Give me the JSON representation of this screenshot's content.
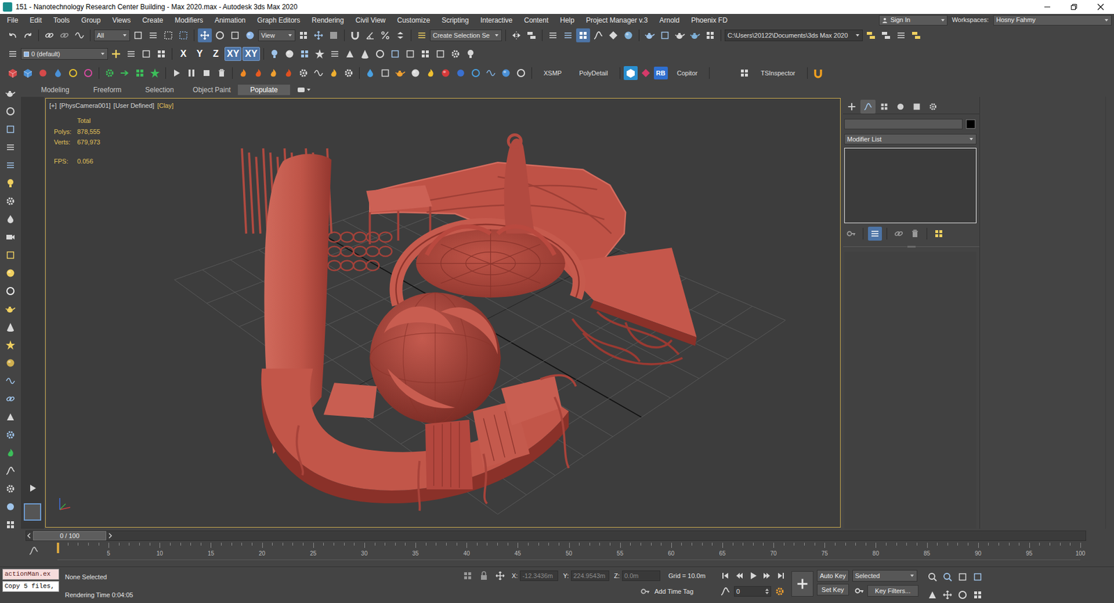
{
  "window": {
    "title": "151 - Nanotechnology Research Center Building - Max 2020.max - Autodesk 3ds Max 2020"
  },
  "menu": [
    "File",
    "Edit",
    "Tools",
    "Group",
    "Views",
    "Create",
    "Modifiers",
    "Animation",
    "Graph Editors",
    "Rendering",
    "Civil View",
    "Customize",
    "Scripting",
    "Interactive",
    "Content",
    "Help",
    "Project Manager v.3",
    "Arnold",
    "Phoenix FD"
  ],
  "account": {
    "sign_in": "Sign In",
    "workspaces_label": "Workspaces:",
    "workspace": "Hosny Fahmy"
  },
  "main_toolbar": {
    "selection_filter": "All",
    "reference_coordinate_system": "View",
    "named_selection_set": "Create Selection Se",
    "project_folder": "C:\\Users\\20122\\Documents\\3ds Max 2020",
    "move_tool_active": true,
    "ribbon_visible": true
  },
  "layer_toolbar": {
    "current_layer": "0 (default)",
    "axis_constraints": [
      {
        "label": "X",
        "selected": false
      },
      {
        "label": "Y",
        "selected": false
      },
      {
        "label": "Z",
        "selected": false
      },
      {
        "label": "XY",
        "selected": true
      },
      {
        "label": "XY",
        "selected": true
      }
    ]
  },
  "plugin_toolbar": [
    {
      "label": "XSMP",
      "kind": "text"
    },
    {
      "label": "PolyDetail",
      "kind": "text"
    },
    {
      "label": "RB",
      "kind": "badge"
    },
    {
      "label": "Copitor",
      "kind": "text"
    },
    {
      "label": "TSInspector",
      "kind": "text"
    }
  ],
  "ribbon_tabs": [
    {
      "label": "Modeling",
      "selected": false
    },
    {
      "label": "Freeform",
      "selected": false
    },
    {
      "label": "Selection",
      "selected": false
    },
    {
      "label": "Object Paint",
      "selected": false
    },
    {
      "label": "Populate",
      "selected": true
    }
  ],
  "viewport": {
    "active": true,
    "labels": [
      {
        "text": "[+]",
        "highlighted": false
      },
      {
        "text": "[PhysCamera001]",
        "highlighted": false
      },
      {
        "text": "[User Defined]",
        "highlighted": false
      },
      {
        "text": "[Clay]",
        "highlighted": true
      }
    ],
    "statistics": {
      "header": "Total",
      "rows": [
        {
          "label": "Polys:",
          "value": "878,555"
        },
        {
          "label": "Verts:",
          "value": "679,973"
        },
        {
          "label": "FPS:",
          "value": "0.056"
        }
      ]
    }
  },
  "command_panel": {
    "tabs": [
      {
        "selected": false
      },
      {
        "selected": true
      },
      {
        "selected": false
      },
      {
        "selected": false
      },
      {
        "selected": false
      },
      {
        "selected": false
      }
    ],
    "object_name": "",
    "object_color": "#000000",
    "modifier_list": "Modifier List"
  },
  "time_slider": {
    "label": "0 / 100",
    "level": 0
  },
  "track_bar": {
    "ticks": [
      "5",
      "10",
      "15",
      "20",
      "25",
      "30",
      "35",
      "40",
      "45",
      "50",
      "55",
      "60",
      "65",
      "70",
      "75",
      "80",
      "85",
      "90",
      "95",
      "100"
    ]
  },
  "status_bar": {
    "listener": [
      {
        "text": "actionMan.ex",
        "kind": "error"
      },
      {
        "text": "Copy 5 files,",
        "kind": "output"
      }
    ],
    "selection": "None Selected",
    "prompt": "Rendering Time 0:04:05",
    "coordinates": [
      {
        "axis": "X:",
        "value": "-12.3436m"
      },
      {
        "axis": "Y:",
        "value": "224.9543m"
      },
      {
        "axis": "Z:",
        "value": "0.0m"
      }
    ],
    "grid": "Grid = 10.0m",
    "add_time_tag": "Add Time Tag",
    "current_frame": "0",
    "auto_key": {
      "label": "Auto Key",
      "on": false
    },
    "set_key": "Set Key",
    "key_selection": "Selected",
    "key_filters": "Key Filters..."
  }
}
